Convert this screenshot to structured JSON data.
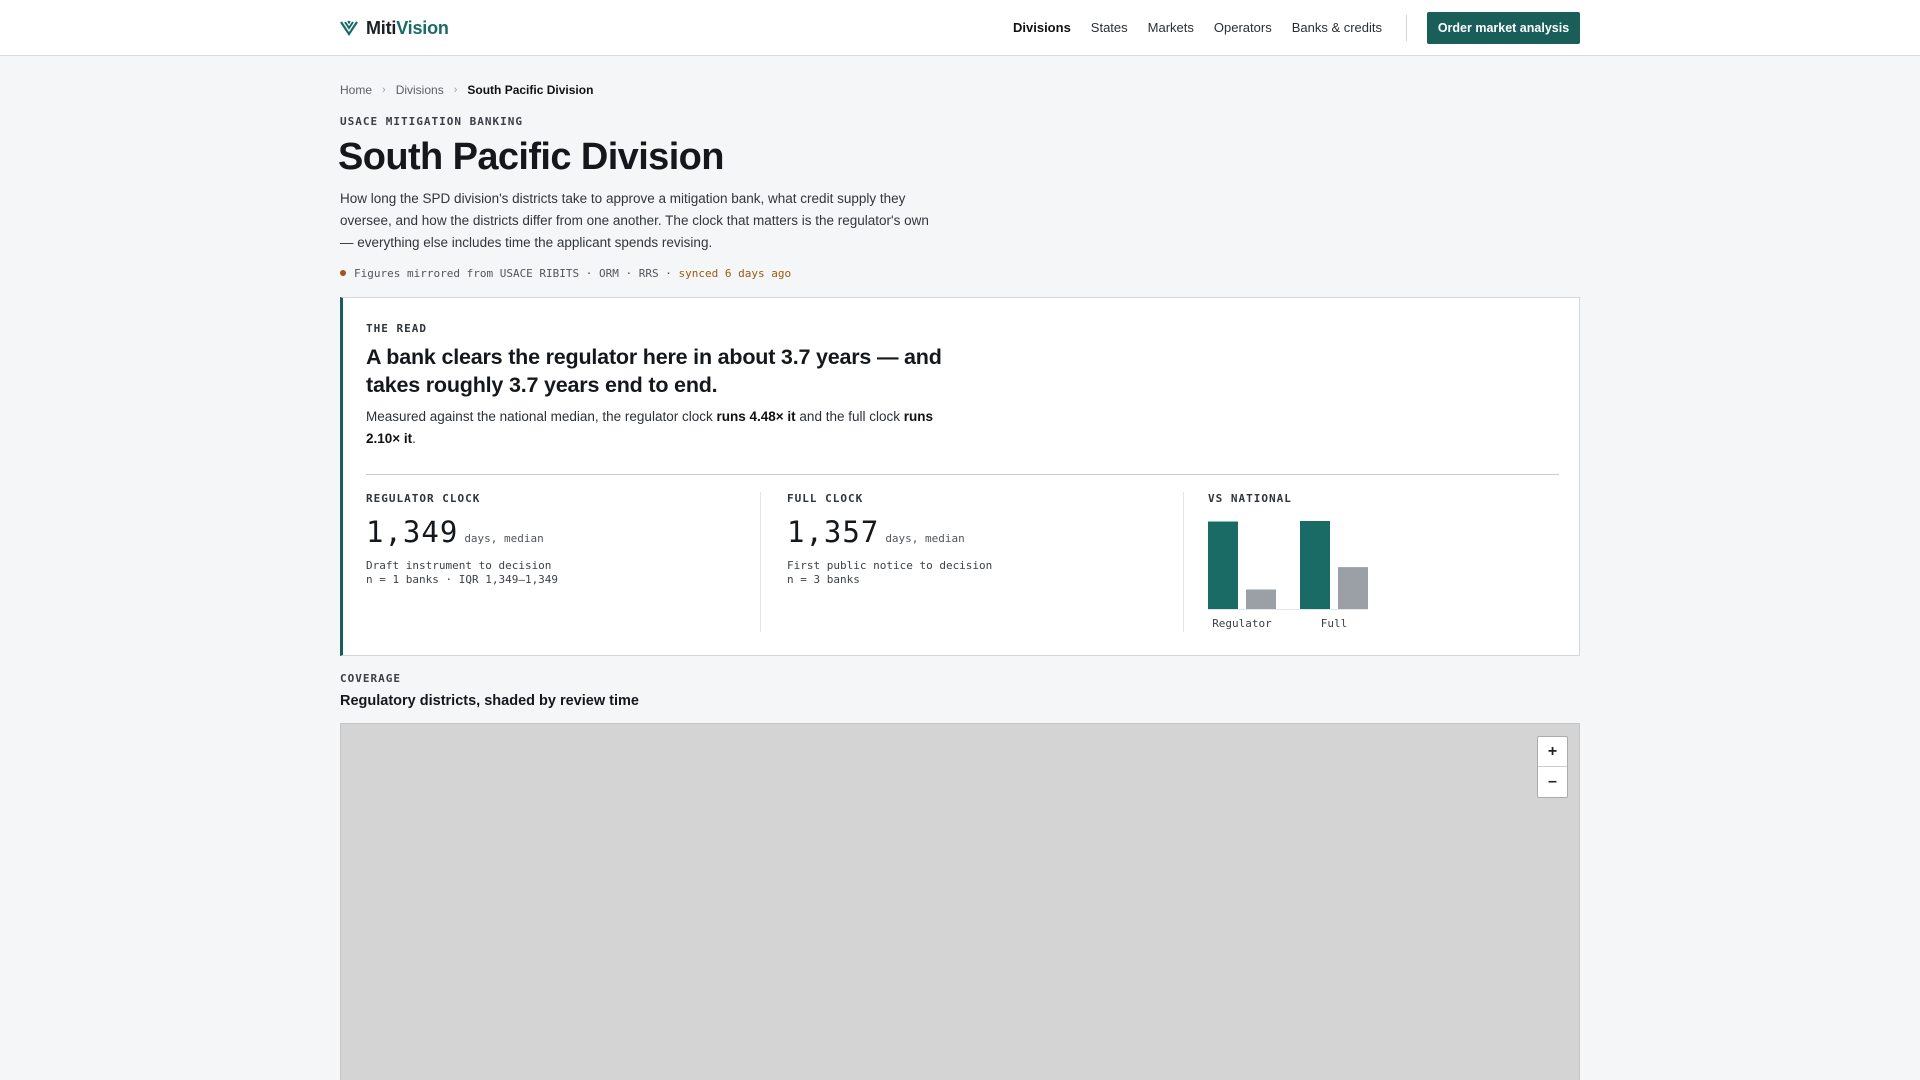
{
  "brand": {
    "name_part1": "Miti",
    "name_part2": "Vision",
    "logo_icon": "shield-chevron-icon"
  },
  "nav": {
    "items": [
      {
        "label": "Divisions",
        "active": true
      },
      {
        "label": "States",
        "active": false
      },
      {
        "label": "Markets",
        "active": false
      },
      {
        "label": "Operators",
        "active": false
      },
      {
        "label": "Banks & credits",
        "active": false
      }
    ],
    "cta_label": "Order market analysis"
  },
  "breadcrumb": [
    "Home",
    "Divisions",
    "South Pacific Division"
  ],
  "header": {
    "eyebrow": "USACE MITIGATION BANKING",
    "title": "South Pacific Division",
    "lede": "How long the SPD division's districts take to approve a mitigation bank, what credit supply they oversee, and how the districts differ from one another. The clock that matters is the regulator's own — everything else includes time the applicant spends revising.",
    "source_text": "Figures mirrored from USACE RIBITS · ORM · RRS ·",
    "sync_text": "synced 6 days ago"
  },
  "read": {
    "label": "THE READ",
    "headline": "A bank clears the regulator here in about 3.7 years — and takes roughly 3.7 years end to end.",
    "body_pre": "Measured against the national median, the regulator clock",
    "body_strong1": "runs 4.48× it",
    "body_mid": "and the full clock",
    "body_strong2": "runs 2.10× it",
    "body_post": "."
  },
  "stats": {
    "regulator": {
      "label": "REGULATOR CLOCK",
      "value": "1,349",
      "unit": "days, median",
      "note1": "Draft instrument to decision",
      "note2": "n = 1 banks · IQR 1,349–1,349"
    },
    "full": {
      "label": "FULL CLOCK",
      "value": "1,357",
      "unit": "days, median",
      "note1": "First public notice to decision",
      "note2": "n = 3 banks"
    },
    "vs_national": {
      "label": "VS NATIONAL"
    }
  },
  "chart_data": {
    "type": "bar",
    "categories": [
      "Regulator",
      "Full"
    ],
    "series": [
      {
        "values": [
          1349,
          1357
        ],
        "color": "#1a6b66"
      },
      {
        "values": [
          301,
          646
        ],
        "color": "#9aa0a6"
      }
    ]
  },
  "coverage": {
    "eyebrow": "COVERAGE",
    "title": "Regulatory districts, shaded by review time",
    "zoom_in": "+",
    "zoom_out": "–"
  }
}
